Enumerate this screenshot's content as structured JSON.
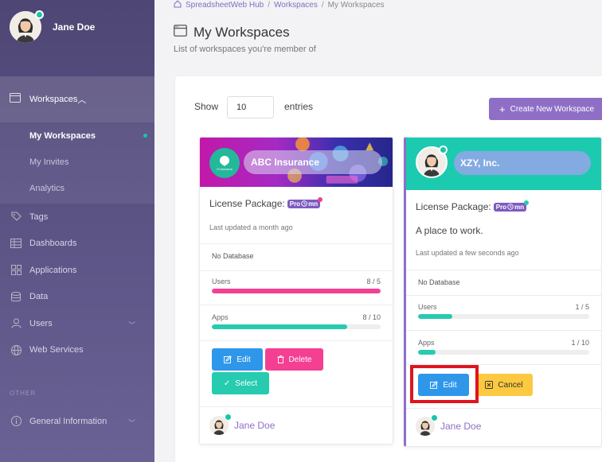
{
  "user": {
    "name": "Jane Doe"
  },
  "sidebar": {
    "workspaces": {
      "label": "Workspaces",
      "items": [
        {
          "label": "My Workspaces",
          "active": true
        },
        {
          "label": "My Invites"
        },
        {
          "label": "Analytics"
        }
      ]
    },
    "items": [
      {
        "label": "Tags",
        "icon": "tag-icon"
      },
      {
        "label": "Dashboards",
        "icon": "table-icon"
      },
      {
        "label": "Applications",
        "icon": "grid-icon"
      },
      {
        "label": "Data",
        "icon": "database-icon"
      },
      {
        "label": "Users",
        "icon": "user-icon"
      },
      {
        "label": "Web Services",
        "icon": "globe-icon"
      }
    ],
    "other_label": "OTHER",
    "general_info": "General Information"
  },
  "breadcrumb": {
    "home": "SpreadsheetWeb Hub",
    "section": "Workspaces",
    "current": "My Workspaces"
  },
  "page": {
    "title": "My Workspaces",
    "subtitle": "List of workspaces you're member of"
  },
  "table_controls": {
    "show_label": "Show",
    "entries_value": "10",
    "entries_label": "entries",
    "create_button": "Create New Workspace"
  },
  "cards": [
    {
      "name": "ABC Insurance",
      "logo_text": "GI insurance",
      "license_label": "License Package:",
      "package_badge": "Pro",
      "package_suffix": "mn",
      "last_updated": "Last updated a month ago",
      "database": "No Database",
      "users": {
        "label": "Users",
        "count": "8 / 5",
        "progress": 1.0
      },
      "apps": {
        "label": "Apps",
        "count": "8 / 10",
        "progress": 0.8
      },
      "buttons": {
        "edit": "Edit",
        "delete": "Delete",
        "select": "Select"
      },
      "owner": "Jane Doe"
    },
    {
      "name": "XZY, Inc.",
      "license_label": "License Package:",
      "package_badge": "Pro",
      "package_suffix": "mn",
      "description": "A place to work.",
      "last_updated": "Last updated a few seconds ago",
      "database": "No Database",
      "users": {
        "label": "Users",
        "count": "1 / 5",
        "progress": 0.2
      },
      "apps": {
        "label": "Apps",
        "count": "1 / 10",
        "progress": 0.1
      },
      "buttons": {
        "edit": "Edit",
        "cancel": "Cancel"
      },
      "owner": "Jane Doe"
    }
  ],
  "colors": {
    "accent": "#8f6fc6",
    "teal": "#26cbb0",
    "pink": "#f43f93",
    "blue": "#2f97ea",
    "yellow": "#fcc940",
    "highlight": "#e0141e"
  }
}
